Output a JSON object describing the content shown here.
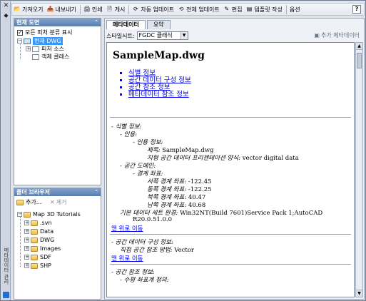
{
  "toolbar": {
    "items": [
      {
        "label": "가져오기",
        "icon": "import-icon"
      },
      {
        "label": "내보내기",
        "icon": "export-icon"
      },
      {
        "label": "인쇄",
        "icon": "print-icon"
      },
      {
        "label": "게시",
        "icon": "publish-icon"
      },
      {
        "label": "자동 업데이트",
        "icon": "auto-update-icon"
      },
      {
        "label": "전체 업데이트",
        "icon": "update-all-icon"
      },
      {
        "label": "편집",
        "icon": "edit-icon"
      },
      {
        "label": "템플릿 작성",
        "icon": "template-icon"
      },
      {
        "label": "옵션",
        "icon": ""
      }
    ],
    "help": "?"
  },
  "current_drawing": {
    "title": "현재 도면",
    "show_all_label": "모든 피처 분류 표시",
    "tree": [
      "현재 DWG",
      "피처 소스",
      "객체 클래스"
    ]
  },
  "folder_browser": {
    "title": "폴더 브라우저",
    "add_label": "추가...",
    "remove_label": "제거",
    "root": "Map 3D Tutorials",
    "children": [
      ".svn",
      "Data",
      "DWG",
      "Images",
      "SDF",
      "SHP"
    ]
  },
  "strip": {
    "title": "메타데이터 관리"
  },
  "tabs": [
    "메타데이터",
    "요약"
  ],
  "style": {
    "label": "스타일시트:",
    "value": "FGDC 클래식",
    "add_metadata": "추가 메타데이터"
  },
  "doc": {
    "title": "SampleMap.dwg",
    "links": [
      "식별 정보",
      "공간 데이터 구성 정보",
      "공간 참조 정보",
      "메타데이터 참조 정보"
    ],
    "ident_heading": "- 식별 정보:",
    "citation": "- 인용:",
    "citation_info": "- 인용 정보:",
    "title_label": "제목:",
    "title_value": "SampleMap.dwg",
    "format_label": "지형 공간 데이터 프리젠테이션 양식:",
    "format_value": "vector digital data",
    "domain": "- 공간 도메인:",
    "bounds": "- 경계 좌표:",
    "west_label": "서쪽 경계 좌표:",
    "west_value": "-122.45",
    "east_label": "동쪽 경계 좌표:",
    "east_value": "-122.25",
    "north_label": "북쪽 경계 좌표:",
    "north_value": "40.47",
    "south_label": "남쪽 경계 좌표:",
    "south_value": "40.68",
    "env_label": "기본 데이터 세트 환경:",
    "env_value": "Win32NT(Build 7601)Service Pack 1;AutoCAD",
    "env_value2": "R20.0.51.0.0",
    "back_to_top": "맨 위로 이동",
    "sdo_heading": "- 공간 데이터 구성 정보:",
    "sdo_label": "직접 공간 참조 방법:",
    "sdo_value": "Vector",
    "back_to_top2": "맨 위로 이동",
    "sr_heading": "- 공간 참조 정보:",
    "sr_sub": "- 수평 좌표계 정의:"
  }
}
